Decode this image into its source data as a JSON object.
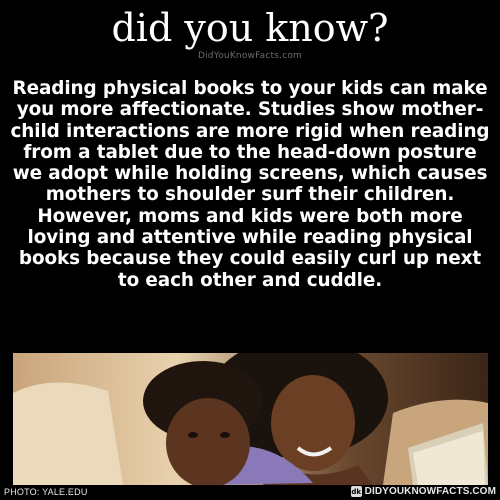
{
  "header": {
    "title": "did you know?",
    "subtitle": "DidYouKnowFacts.com"
  },
  "fact": {
    "text": "Reading physical books to your kids can make you more affectionate. Studies show mother-child interactions are more rigid when reading from a tablet due to the head-down posture we adopt while holding screens, which causes mothers to shoulder surf their children. However, moms and kids were both more loving and attentive while reading physical books because they could easily curl up next to each other and cuddle."
  },
  "footer": {
    "credit": "PHOTO: YALE.EDU",
    "brand_logo": "dk",
    "brand": "DIDYOUKNOWFACTS.COM"
  },
  "colors": {
    "background": "#000000",
    "text": "#ffffff",
    "subtitle": "#6d6d6d"
  }
}
